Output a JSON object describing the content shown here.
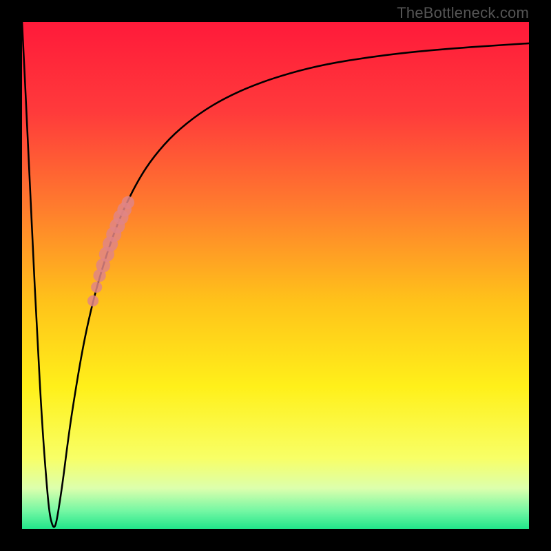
{
  "watermark": "TheBottleneck.com",
  "colors": {
    "frame": "#000000",
    "curve": "#000000",
    "marker": "#e08585",
    "gradient_stops": [
      {
        "pos": 0.0,
        "color": "#ff1a3a"
      },
      {
        "pos": 0.18,
        "color": "#ff3b3b"
      },
      {
        "pos": 0.36,
        "color": "#ff7a2e"
      },
      {
        "pos": 0.55,
        "color": "#ffc21a"
      },
      {
        "pos": 0.72,
        "color": "#fff01a"
      },
      {
        "pos": 0.86,
        "color": "#f8ff66"
      },
      {
        "pos": 0.92,
        "color": "#dcffad"
      },
      {
        "pos": 0.965,
        "color": "#73f7a3"
      },
      {
        "pos": 1.0,
        "color": "#20e58a"
      }
    ]
  },
  "chart_data": {
    "type": "line",
    "title": "",
    "xlabel": "",
    "ylabel": "",
    "xlim": [
      0,
      100
    ],
    "ylim": [
      0,
      100
    ],
    "series": [
      {
        "name": "bottleneck-curve",
        "x": [
          0,
          1,
          2,
          3,
          4,
          5,
          5.5,
          6,
          6.3,
          6.6,
          7,
          8,
          9,
          10,
          12,
          14,
          16,
          18,
          20,
          23,
          26,
          30,
          35,
          40,
          46,
          53,
          60,
          68,
          76,
          85,
          92,
          100
        ],
        "y": [
          100,
          80,
          58,
          38,
          20,
          7,
          2.5,
          0.7,
          0.3,
          0.7,
          2.5,
          9,
          17,
          24,
          36,
          45,
          52,
          58,
          63,
          69,
          73.5,
          78,
          82,
          85,
          87.7,
          90,
          91.7,
          93,
          94,
          94.8,
          95.3,
          95.8
        ]
      }
    ],
    "markers": {
      "name": "highlighted-range",
      "on_series": "bottleneck-curve",
      "points": [
        {
          "x": 14.0,
          "y": 45.0,
          "r": 1.1
        },
        {
          "x": 14.7,
          "y": 47.7,
          "r": 1.1
        },
        {
          "x": 15.3,
          "y": 50.0,
          "r": 1.25
        },
        {
          "x": 16.0,
          "y": 52.0,
          "r": 1.4
        },
        {
          "x": 16.7,
          "y": 54.2,
          "r": 1.5
        },
        {
          "x": 17.4,
          "y": 56.2,
          "r": 1.5
        },
        {
          "x": 18.1,
          "y": 58.1,
          "r": 1.5
        },
        {
          "x": 18.8,
          "y": 59.8,
          "r": 1.5
        },
        {
          "x": 19.5,
          "y": 61.5,
          "r": 1.5
        },
        {
          "x": 20.2,
          "y": 63.0,
          "r": 1.4
        },
        {
          "x": 20.9,
          "y": 64.4,
          "r": 1.25
        }
      ]
    }
  }
}
